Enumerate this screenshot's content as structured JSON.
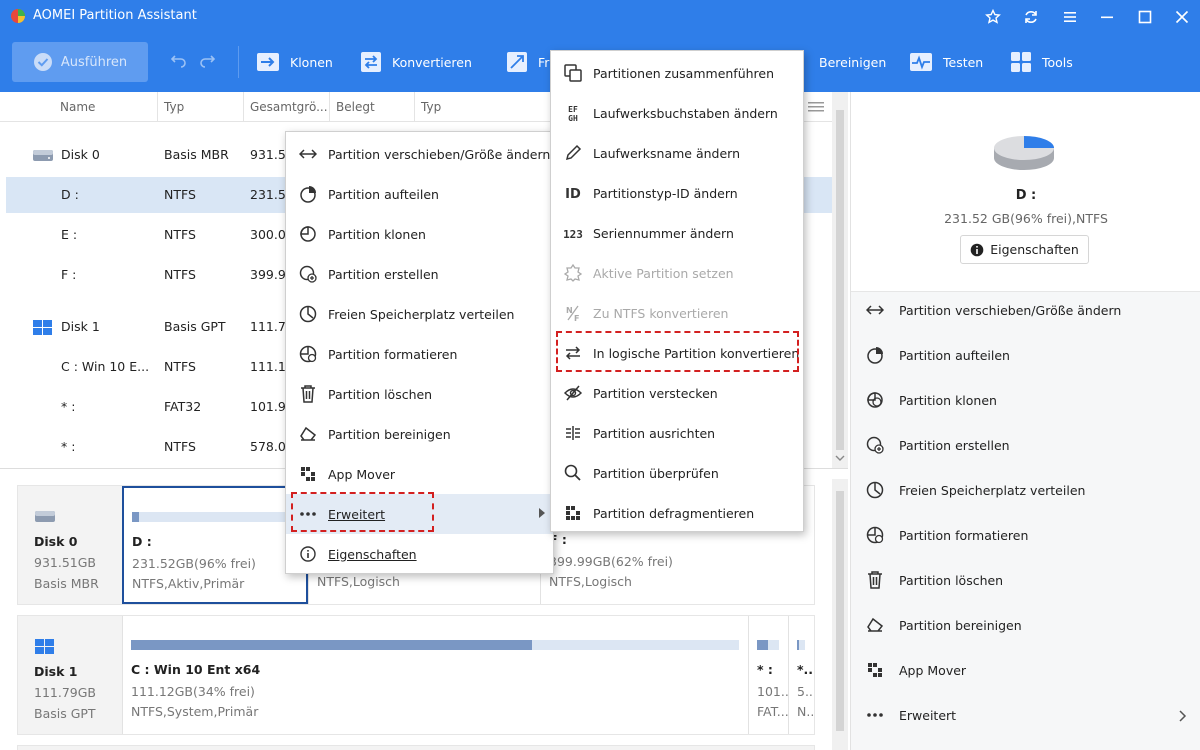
{
  "window": {
    "title": "AOMEI Partition Assistant"
  },
  "toolbar": {
    "apply": "Ausführen",
    "items": [
      "Klonen",
      "Konvertieren",
      "Fr",
      "Bereinigen",
      "Testen",
      "Tools"
    ]
  },
  "table": {
    "headers": [
      "Name",
      "Typ",
      "Gesamtgrö...",
      "Belegt",
      "Typ"
    ],
    "rows": [
      {
        "name": "Disk 0",
        "type": "Basis MBR",
        "size": "931.51G",
        "disk": true
      },
      {
        "name": "D :",
        "type": "NTFS",
        "size": "231.52",
        "selected": true
      },
      {
        "name": "E :",
        "type": "NTFS",
        "size": "300.00"
      },
      {
        "name": "F :",
        "type": "NTFS",
        "size": "399.99"
      },
      {
        "name": "Disk 1",
        "type": "Basis GPT",
        "size": "111.79G",
        "disk": true
      },
      {
        "name": "C : Win 10 E...",
        "type": "NTFS",
        "size": "111.12G"
      },
      {
        "name": "* :",
        "type": "FAT32",
        "size": "101.98"
      },
      {
        "name": "* :",
        "type": "NTFS",
        "size": "578.00"
      }
    ]
  },
  "disk_map": {
    "disk0": {
      "name": "Disk 0",
      "size": "931.51GB",
      "type": "Basis MBR",
      "partitions": [
        {
          "name": "D :",
          "info1": "231.52GB(96% frei)",
          "info2": "NTFS,Aktiv,Primär",
          "used": 0.04
        },
        {
          "name": "",
          "info1": "",
          "info2": "NTFS,Logisch",
          "used": 0.2
        },
        {
          "name": "F :",
          "info1": "399.99GB(62% frei)",
          "info2": "NTFS,Logisch",
          "used": 0.38
        }
      ]
    },
    "disk1": {
      "name": "Disk 1",
      "size": "111.79GB",
      "type": "Basis GPT",
      "partitions": [
        {
          "name": "C : Win 10 Ent x64",
          "info1": "111.12GB(34% frei)",
          "info2": "NTFS,System,Primär",
          "used": 0.66
        },
        {
          "name": "* :",
          "info1": "101...",
          "info2": "FAT...",
          "used": 0.5
        },
        {
          "name": "*...",
          "info1": "5...",
          "info2": "N...",
          "used": 0.3
        }
      ]
    }
  },
  "right_panel": {
    "drive": "D :",
    "drive_info": "231.52 GB(96% frei),NTFS",
    "properties_button": "Eigenschaften",
    "operations": [
      {
        "label": "Partition verschieben/Größe ändern",
        "icon": "resize-icon"
      },
      {
        "label": "Partition aufteilen",
        "icon": "split-icon"
      },
      {
        "label": "Partition klonen",
        "icon": "clone-icon"
      },
      {
        "label": "Partition erstellen",
        "icon": "create-icon"
      },
      {
        "label": "Freien Speicherplatz verteilen",
        "icon": "allocate-icon"
      },
      {
        "label": "Partition formatieren",
        "icon": "format-icon"
      },
      {
        "label": "Partition löschen",
        "icon": "trash-icon"
      },
      {
        "label": "Partition bereinigen",
        "icon": "eraser-icon"
      },
      {
        "label": "App Mover",
        "icon": "app-mover-icon"
      },
      {
        "label": "Erweitert",
        "icon": "more-icon"
      }
    ]
  },
  "context_menu": {
    "items": [
      "Partition verschieben/Größe ändern",
      "Partition aufteilen",
      "Partition klonen",
      "Partition erstellen",
      "Freien Speicherplatz verteilen",
      "Partition formatieren",
      "Partition löschen",
      "Partition bereinigen",
      "App Mover",
      "Erweitert",
      "Eigenschaften"
    ]
  },
  "submenu": {
    "items": [
      {
        "label": "Partitionen zusammenführen",
        "disabled": false
      },
      {
        "label": "Laufwerksbuchstaben ändern",
        "disabled": false
      },
      {
        "label": "Laufwerksname ändern",
        "disabled": false
      },
      {
        "label": "Partitionstyp-ID ändern",
        "disabled": false
      },
      {
        "label": "Seriennummer ändern",
        "disabled": false
      },
      {
        "label": "Aktive Partition setzen",
        "disabled": true
      },
      {
        "label": "Zu NTFS konvertieren",
        "disabled": true
      },
      {
        "label": "In logische Partition konvertieren",
        "disabled": false
      },
      {
        "label": "Partition verstecken",
        "disabled": false
      },
      {
        "label": "Partition ausrichten",
        "disabled": false
      },
      {
        "label": "Partition überprüfen",
        "disabled": false
      },
      {
        "label": "Partition defragmentieren",
        "disabled": false
      }
    ],
    "icon_text": {
      "drive_letter": "EFGH",
      "type_id": "ID",
      "serial": "123",
      "ntfs": "N/F"
    }
  },
  "colors": {
    "titlebar": "#2f7ee9",
    "selection": "#d9e6f5",
    "highlight_box": "#d32020",
    "pie_used": "#2f7ee9"
  }
}
